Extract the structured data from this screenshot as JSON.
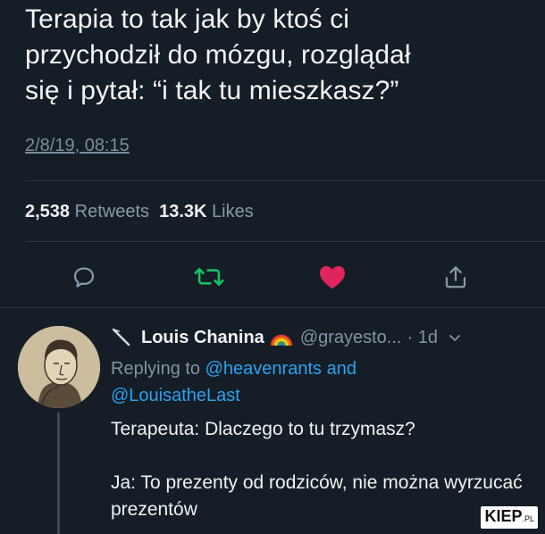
{
  "tweet": {
    "text_line1": "Terapia to tak jak by ktoś ci",
    "text_line2": "przychodził do mózgu, rozglądał",
    "text_line3": "się i pytał: “i tak tu mieszkasz?”",
    "timestamp": "2/8/19, 08:15",
    "retweets_count": "2,538",
    "retweets_label": "Retweets",
    "likes_count": "13.3K",
    "likes_label": "Likes",
    "liked": true
  },
  "colors": {
    "background": "#151d26",
    "retweet_green": "#19bf63",
    "like_red": "#e0245e",
    "link_blue": "#2aa3ef",
    "muted_gray": "#8593a1"
  },
  "actions": [
    {
      "name": "reply",
      "icon": "speech-bubble-icon"
    },
    {
      "name": "retweet",
      "icon": "retweet-icon"
    },
    {
      "name": "like",
      "icon": "heart-icon"
    },
    {
      "name": "share",
      "icon": "share-icon"
    }
  ],
  "reply": {
    "name": "Louis Chanina",
    "handle": "@grayesto...",
    "age": "· 1d",
    "replying_prefix": "Replying to",
    "mention1": "@heavenrants",
    "and_word": "and",
    "mention2": "@LouisatheLast",
    "body_line1": "Terapeuta: Dlaczego to tu trzymasz?",
    "body_line2": "Ja: To prezenty od rodziców, nie można wyrzucać prezentów"
  },
  "watermark": {
    "main": "KIEP",
    "suffix": ".PL"
  }
}
